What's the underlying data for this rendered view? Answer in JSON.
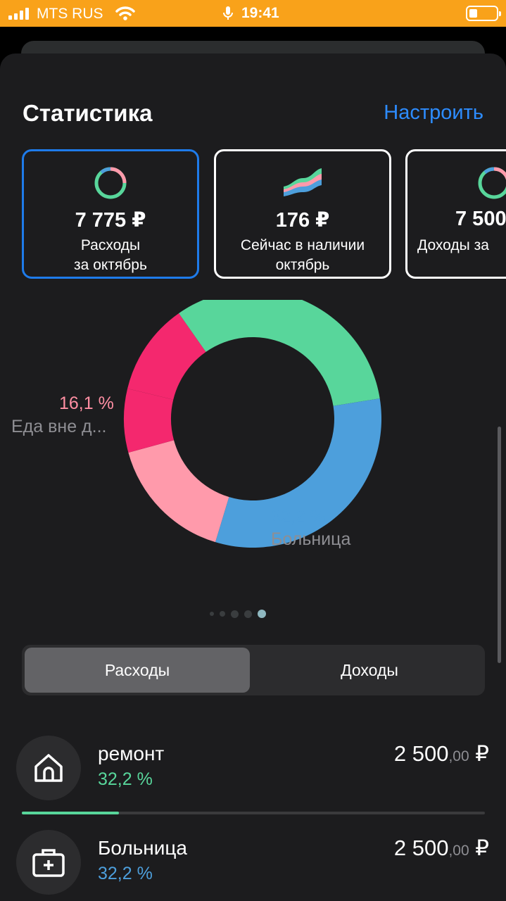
{
  "status_bar": {
    "carrier": "MTS RUS",
    "time": "19:41"
  },
  "header": {
    "title": "Статистика",
    "configure_label": "Настроить"
  },
  "cards": [
    {
      "amount": "7 775 ₽",
      "label_line1": "Расходы",
      "label_line2": "за октябрь",
      "icon": "donut-icon",
      "active": true
    },
    {
      "amount": "176 ₽",
      "label_line1": "Сейчас в наличии",
      "label_line2": "октябрь",
      "icon": "wave-chart-icon",
      "active": false
    },
    {
      "amount": "7 500",
      "label_line1": "Доходы за",
      "label_line2": "",
      "icon": "donut-icon",
      "active": false
    }
  ],
  "chart_data": {
    "type": "pie",
    "categories": [
      "ремонт",
      "Больница",
      "Еда вне д...",
      "",
      ""
    ],
    "values": [
      32.2,
      32.2,
      16.1,
      8.0,
      11.5
    ],
    "colors": [
      "#58d69b",
      "#4d9fdc",
      "#ff9aab",
      "#f4286e",
      "#f4286e"
    ],
    "visible_labels": [
      {
        "percent": "16,1 %",
        "name": "Еда вне д...",
        "color": "#ff8fa3"
      },
      {
        "percent": "32,2 %",
        "name": "Больница",
        "color": "#4d9fdc"
      }
    ]
  },
  "pager": {
    "count": 5,
    "active_index": 4
  },
  "segment": {
    "expenses_label": "Расходы",
    "income_label": "Доходы"
  },
  "list": [
    {
      "name": "ремонт",
      "percent": "32,2 %",
      "amount_main": "2 500",
      "amount_cents": ",00",
      "currency": " ₽",
      "color": "#58d69b",
      "icon": "house-icon",
      "progress": 0.322
    },
    {
      "name": "Больница",
      "percent": "32,2 %",
      "amount_main": "2 500",
      "amount_cents": ",00",
      "currency": " ₽",
      "color": "#4d9fdc",
      "icon": "medkit-icon",
      "progress": 0.322
    }
  ]
}
